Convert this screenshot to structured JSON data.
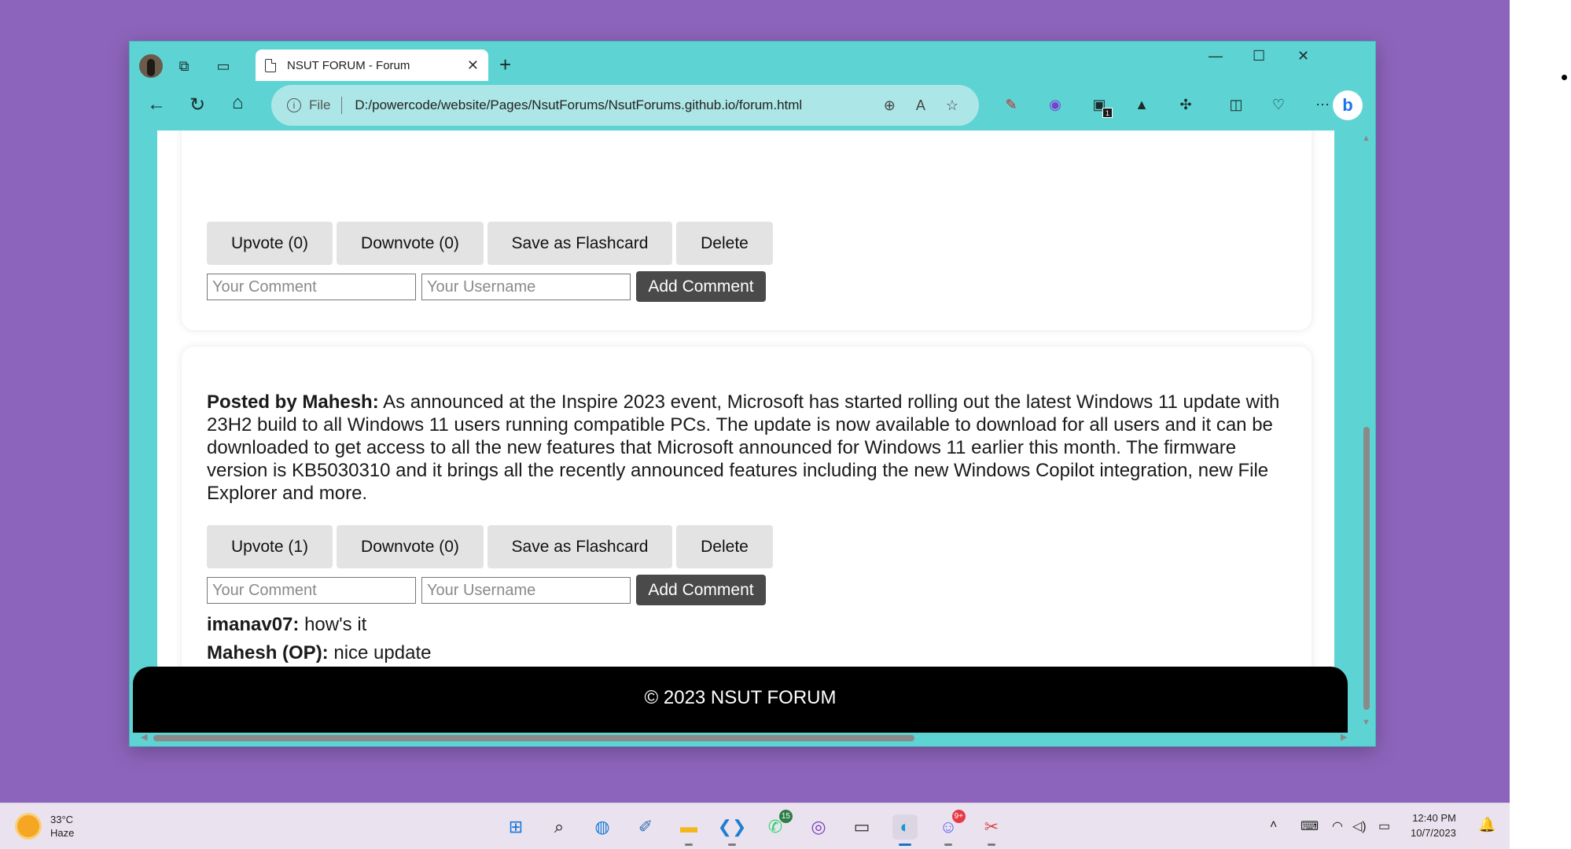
{
  "browser": {
    "tab_title": "NSUT FORUM - Forum",
    "tab_close": "✕",
    "new_tab": "+",
    "address_scheme": "File",
    "address_url": "D:/powercode/website/Pages/NsutForums/NsutForums.github.io/forum.html",
    "extension_badge": "1",
    "bing_label": "b",
    "window_controls": {
      "minimize": "—",
      "maximize": "☐",
      "close": "✕"
    }
  },
  "posts": [
    {
      "buttons": {
        "upvote": "Upvote (0)",
        "downvote": "Downvote (0)",
        "flashcard": "Save as Flashcard",
        "delete": "Delete"
      },
      "comment_placeholder": "Your Comment",
      "username_placeholder": "Your Username",
      "add_comment": "Add Comment"
    },
    {
      "author_prefix": "Posted by Mahesh:",
      "body": " As announced at the Inspire 2023 event, Microsoft has started rolling out the latest Windows 11 update with 23H2 build to all Windows 11 users running compatible PCs. The update is now available to download for all users and it can be downloaded to get access to all the new features that Microsoft announced for Windows 11 earlier this month. The firmware version is KB5030310 and it brings all the recently announced features including the new Windows Copilot integration, new File Explorer and more.",
      "buttons": {
        "upvote": "Upvote (1)",
        "downvote": "Downvote (0)",
        "flashcard": "Save as Flashcard",
        "delete": "Delete"
      },
      "comment_placeholder": "Your Comment",
      "username_placeholder": "Your Username",
      "add_comment": "Add Comment",
      "comments": [
        {
          "user": "imanav07:",
          "text": " how's it"
        },
        {
          "user": "Mahesh (OP):",
          "text": " nice update"
        }
      ]
    }
  ],
  "footer": {
    "text": "© 2023 NSUT FORUM"
  },
  "taskbar": {
    "weather_temp": "33°C",
    "weather_desc": "Haze",
    "whatsapp_badge": "15",
    "discord_badge": "9+",
    "time": "12:40 PM",
    "date": "10/7/2023"
  },
  "colors": {
    "desktop": "#8d64bb",
    "browser_frame": "#5dd3d3",
    "button": "#e3e3e3",
    "add_comment_button": "#4a4a4a",
    "footer": "#000000"
  }
}
